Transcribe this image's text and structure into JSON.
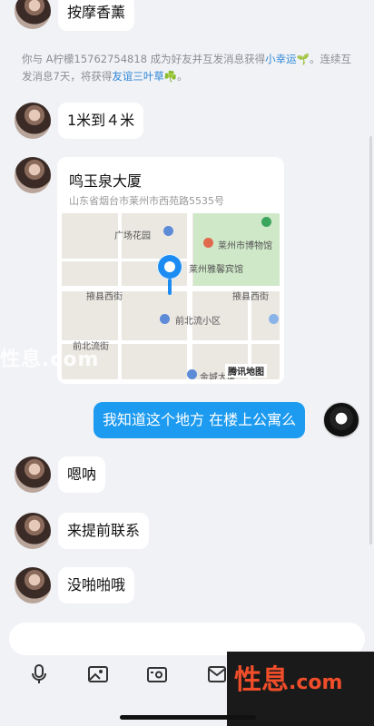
{
  "messages": {
    "m0": "按摩香薰",
    "system": {
      "prefix": "你与 A柠檬15762754818 成为好友并互发消息获得",
      "badge1": "小幸运🌱",
      "middle": "。连续互发消息7天，将获得",
      "badge2": "友谊三叶草☘️",
      "suffix": "。"
    },
    "m1": "1米到４米",
    "location": {
      "title": "鸣玉泉大厦",
      "address": "山东省烟台市莱州市西苑路5535号",
      "map_labels": {
        "l1": "广场花园",
        "l2": "莱州市博物馆",
        "l3": "莱州雅馨宾馆",
        "l4": "掖县西街",
        "l5": "掖县西街",
        "l6": "前北流小区",
        "l7": "前北流街",
        "l8": "金城大厦",
        "provider": "腾讯地图"
      }
    },
    "m2": "我知道这个地方 在楼上公寓么",
    "m3": "嗯呐",
    "m4": "来提前联系",
    "m5": "没啪啪哦"
  },
  "watermark": {
    "left": "性息.com",
    "cn": "性息",
    "dot_com": ".com"
  },
  "colors": {
    "accent": "#1d9bf0",
    "background": "#f1f2f6",
    "link": "#2d87d6"
  },
  "icons": [
    "microphone-icon",
    "image-icon",
    "camera-icon",
    "file-icon"
  ]
}
